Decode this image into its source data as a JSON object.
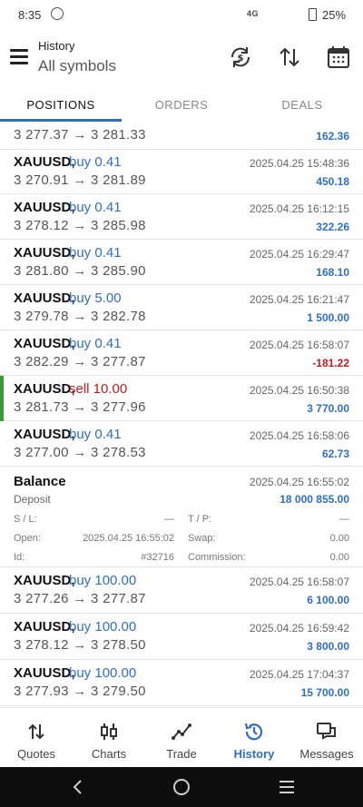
{
  "status": {
    "time": "8:35",
    "network": "4G",
    "battery": "25%"
  },
  "header": {
    "title": "History",
    "subtitle": "All symbols"
  },
  "tabs": [
    "POSITIONS",
    "ORDERS",
    "DEALS"
  ],
  "partial_row": {
    "prices": "3 277.37 → 3 281.33",
    "profit": "162.36"
  },
  "deals": [
    {
      "symbol": "XAUUSD,",
      "action": "buy 0.41",
      "prices": "3 270.91 → 3 281.89",
      "time": "2025.04.25 15:48:36",
      "profit": "450.18"
    },
    {
      "symbol": "XAUUSD,",
      "action": "buy 0.41",
      "prices": "3 278.12 → 3 285.98",
      "time": "2025.04.25 16:12:15",
      "profit": "322.26"
    },
    {
      "symbol": "XAUUSD,",
      "action": "buy 0.41",
      "prices": "3 281.80 → 3 285.90",
      "time": "2025.04.25 16:29:47",
      "profit": "168.10"
    },
    {
      "symbol": "XAUUSD,",
      "action": "buy 5.00",
      "prices": "3 279.78 → 3 282.78",
      "time": "2025.04.25 16:21:47",
      "profit": "1 500.00"
    },
    {
      "symbol": "XAUUSD,",
      "action": "buy 0.41",
      "prices": "3 282.29 → 3 277.87",
      "time": "2025.04.25 16:58:07",
      "profit": "-181.22"
    },
    {
      "symbol": "XAUUSD,",
      "action": "sell 10.00",
      "prices": "3 281.73 → 3 277.96",
      "time": "2025.04.25 16:50:38",
      "profit": "3 770.00"
    },
    {
      "symbol": "XAUUSD,",
      "action": "buy 0.41",
      "prices": "3 277.00 → 3 278.53",
      "time": "2025.04.25 16:58:06",
      "profit": "62.73"
    }
  ],
  "balance": {
    "title": "Balance",
    "type": "Deposit",
    "time": "2025.04.25 16:55:02",
    "amount": "18 000 855.00",
    "sl_label": "S / L:",
    "sl_value": "—",
    "tp_label": "T / P:",
    "tp_value": "—",
    "open_label": "Open:",
    "open_value": "2025.04.25 16:55:02",
    "swap_label": "Swap:",
    "swap_value": "0.00",
    "id_label": "Id:",
    "id_value": "#32716",
    "commission_label": "Commission:",
    "commission_value": "0.00"
  },
  "deals2": [
    {
      "symbol": "XAUUSD,",
      "action": "buy 100.00",
      "prices": "3 277.26 → 3 277.87",
      "time": "2025.04.25 16:58:07",
      "profit": "6 100.00"
    },
    {
      "symbol": "XAUUSD,",
      "action": "buy 100.00",
      "prices": "3 278.12 → 3 278.50",
      "time": "2025.04.25 16:59:42",
      "profit": "3 800.00"
    },
    {
      "symbol": "XAUUSD,",
      "action": "buy 100.00",
      "prices": "3 277.93 → 3 279.50",
      "time": "2025.04.25 17:04:37",
      "profit": "15 700.00"
    }
  ],
  "nav": [
    {
      "label": "Quotes",
      "icon": "quotes-icon"
    },
    {
      "label": "Charts",
      "icon": "charts-icon"
    },
    {
      "label": "Trade",
      "icon": "trade-icon"
    },
    {
      "label": "History",
      "icon": "history-icon"
    },
    {
      "label": "Messages",
      "icon": "messages-icon"
    }
  ],
  "colors": {
    "accent": "#2f6fc1",
    "negative": "#c41a1a",
    "sell_marker": "#3a9b3a"
  }
}
